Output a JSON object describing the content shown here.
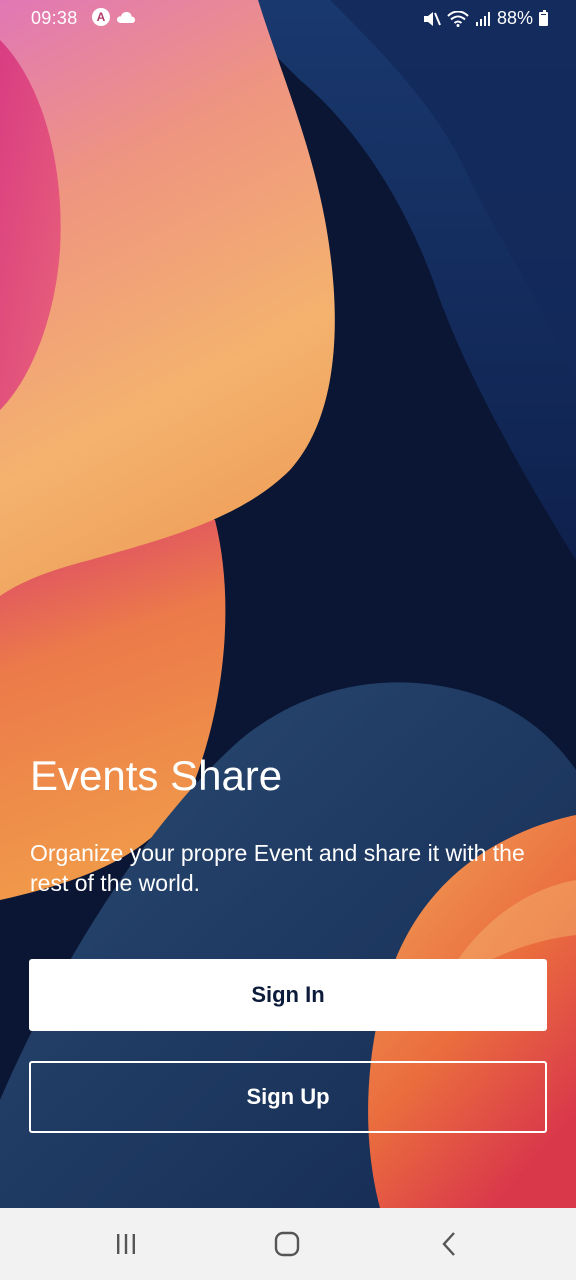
{
  "status_bar": {
    "time": "09:38",
    "battery_percent": "88%",
    "battery_level": 0.88,
    "icons": [
      "app-notification-icon",
      "cloud-icon",
      "mute-icon",
      "wifi-icon",
      "signal-icon",
      "battery-icon"
    ]
  },
  "main": {
    "title": "Events Share",
    "subtitle": "Organize your propre Event and share it with the rest of the world."
  },
  "buttons": {
    "sign_in": "Sign In",
    "sign_up": "Sign Up"
  },
  "nav_bar": {
    "icons": [
      "recents-icon",
      "home-icon",
      "back-icon"
    ]
  },
  "colors": {
    "background": "#0b1838",
    "button_text": "#0d1b3a",
    "nav_bar": "#f2f2f2"
  }
}
